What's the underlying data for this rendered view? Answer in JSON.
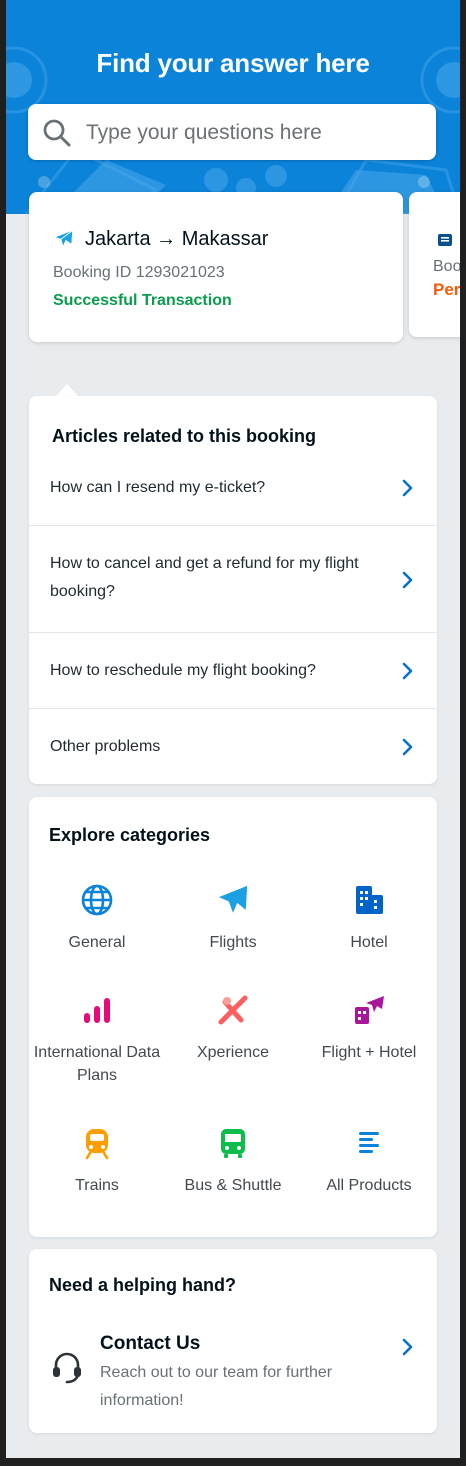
{
  "colors": {
    "brand_blue": "#0b83d9",
    "link_blue": "#0770cd",
    "success_green": "#0a9d4e",
    "pending_orange": "#f25b0c",
    "background": "#e8ecee"
  },
  "hero": {
    "title": "Find your answer here",
    "search_placeholder": "Type your questions here",
    "search_icon": "search-icon"
  },
  "bookings": [
    {
      "icon": "airplane-icon",
      "route": "Jakarta → Makassar",
      "booking_id": "Booking ID 1293021023",
      "status": "Successful Transaction"
    },
    {
      "icon": "document-icon",
      "booking_id": "Boo",
      "status": "Per"
    }
  ],
  "articles": {
    "title": "Articles related to this booking",
    "items": [
      {
        "label": "How can I resend my e-ticket?"
      },
      {
        "label": "How to cancel and get a refund for my flight booking?"
      },
      {
        "label": "How to reschedule my flight booking?"
      },
      {
        "label": "Other problems"
      }
    ]
  },
  "categories": {
    "title": "Explore categories",
    "items": [
      {
        "label": "General",
        "icon": "globe-icon",
        "color": "#0b83d9"
      },
      {
        "label": "Flights",
        "icon": "airplane-icon",
        "color": "#1ba0e2"
      },
      {
        "label": "Hotel",
        "icon": "building-icon",
        "color": "#0264c8"
      },
      {
        "label": "International Data Plans",
        "icon": "signal-bars-icon",
        "color": "#e7097a"
      },
      {
        "label": "Xperience",
        "icon": "xperience-icon",
        "color": "#ff5e5e"
      },
      {
        "label": "Flight + Hotel",
        "icon": "flight-hotel-icon",
        "color": "#a8169b"
      },
      {
        "label": "Trains",
        "icon": "train-icon",
        "color": "#ff9e00"
      },
      {
        "label": "Bus & Shuttle",
        "icon": "bus-icon",
        "color": "#0dbd4c"
      },
      {
        "label": "All Products",
        "icon": "list-icon",
        "color": "#0b83d9"
      }
    ]
  },
  "help": {
    "title": "Need a helping hand?",
    "contact_title": "Contact Us",
    "contact_desc": "Reach out to our team for further information!"
  }
}
